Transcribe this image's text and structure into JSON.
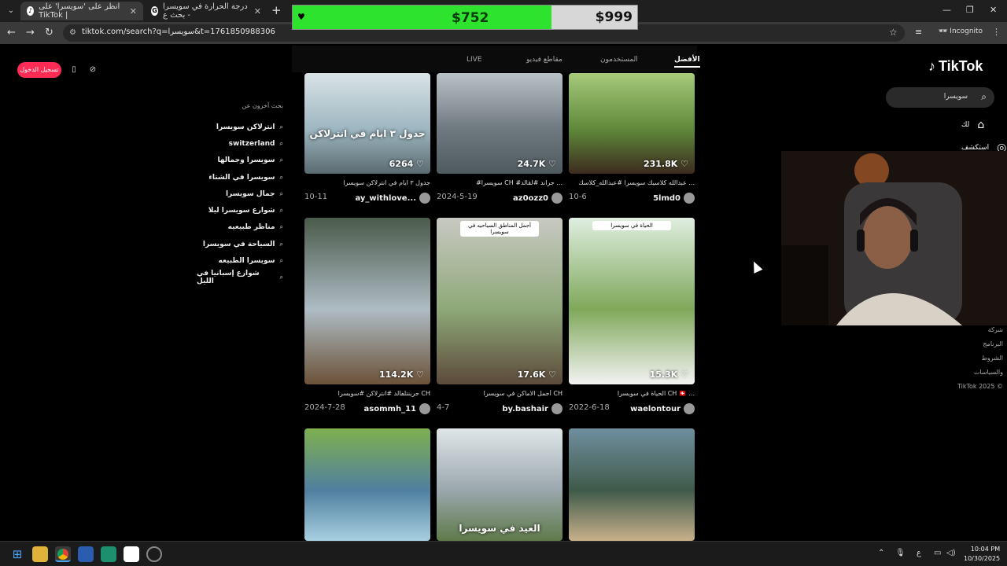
{
  "browser": {
    "tabs": [
      {
        "title": "انظر على 'سويسرا' على TikTok |",
        "icon": "tiktok-icon",
        "active": true
      },
      {
        "title": "درجة الحرارة في سويسرا - بحث ع",
        "icon": "google-icon",
        "active": false
      }
    ],
    "url": "tiktok.com/search?q=سويسرا&t=1761850988306",
    "incognito_label": "Incognito"
  },
  "price_overlay": {
    "current": "$752",
    "target": "$999",
    "progress": 0.75,
    "fill_color": "#2ee32e"
  },
  "tiktok": {
    "login_label": "تسجيل الدخول",
    "logo": "TikTok",
    "search_query": "سويسرا",
    "side_nav": [
      {
        "label": "لك",
        "icon": "home-icon"
      },
      {
        "label": "استكشف",
        "icon": "compass-icon"
      }
    ],
    "footer_links": [
      "شركة",
      "البرنامج",
      "الشروط والسياسات",
      "TikTok 2025 ©"
    ],
    "tabs": [
      "الأفضل",
      "المستخدمون",
      "مقاطع فيديو",
      "LIVE"
    ],
    "related": {
      "heading": "بحث آخرون عن",
      "items": [
        "انترلاكن سويسرا",
        "switzerland",
        "سويسرا وجمالها",
        "سويسرا في الشتاء",
        "جمال سويسرا",
        "شوارع سويسرا ليلا",
        "مناظر طبيعيه",
        "السياحة في سويسرا",
        "سويسرا الطبيعه",
        "شوارع إسبانيا في الليل"
      ]
    },
    "videos": [
      {
        "likes": "231.8K",
        "caption": "عبدالله كلاسيك سويسرا #عبدالله_كلاسك ...",
        "author": "5lmd0",
        "date": "10-6",
        "overlay": "",
        "banner": ""
      },
      {
        "likes": "24.7K",
        "caption": "#سويسرا CH #جراند #لقالد ...",
        "author": "az0ozz0",
        "date": "2024-5-19",
        "overlay": "",
        "banner": ""
      },
      {
        "likes": "6264",
        "caption": "جدول ٣ ايام في انترلاكن سويسرا",
        "author": "ay_withlove...",
        "date": "10-11",
        "overlay": "جدول ٣ ايام في انترلاكن",
        "banner": ""
      },
      {
        "likes": "15.3K",
        "caption": "الحياة في سويسرا CH 🇨🇭 ...",
        "author": "waelontour",
        "date": "2022-6-18",
        "overlay": "",
        "banner": "الحياة في سويسرا"
      },
      {
        "likes": "17.6K",
        "caption": "أجمل الاماكن في سويسرا CH",
        "author": "by.bashair",
        "date": "4-7",
        "overlay": "",
        "banner": "أجمل المناطق السياحيه في سويسرا"
      },
      {
        "likes": "114.2K",
        "caption": "جرينتلفالد #انترلاكن #سويسرا CH",
        "author": "asommh_11",
        "date": "2024-7-28",
        "overlay": "",
        "banner": ""
      },
      {
        "likes": "",
        "caption": "",
        "author": "",
        "date": "",
        "overlay": "",
        "banner": ""
      },
      {
        "likes": "",
        "caption": "",
        "author": "",
        "date": "",
        "overlay": "العيد في سويسرا",
        "banner": ""
      },
      {
        "likes": "",
        "caption": "",
        "author": "",
        "date": "",
        "overlay": "",
        "banner": ""
      }
    ]
  },
  "taskbar": {
    "time": "10:04 PM",
    "date": "10/30/2025",
    "lang": "ع"
  }
}
